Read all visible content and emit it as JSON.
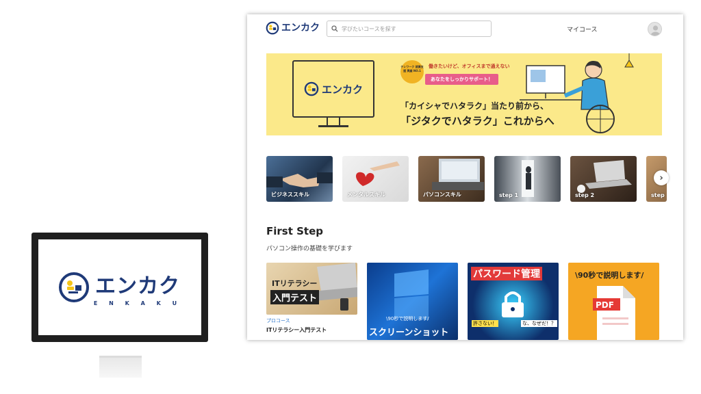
{
  "brand": {
    "logo_text": "エンカク",
    "logo_sub": "E N K A K U"
  },
  "header": {
    "search_placeholder": "学びたいコースを探す",
    "my_course_label": "マイコース"
  },
  "hero": {
    "badge_text": "テレワーク 就業支援 実績 NO.1",
    "small_text": "働きたいけど、オフィスまで通えない",
    "pink_text": "あなたをしっかりサポート！",
    "line1": "「カイシャでハタラク」当たり前から、",
    "line2": "「ジタクでハタラク」これからへ"
  },
  "categories": [
    {
      "label": "ビジネススキル"
    },
    {
      "label": "メンタルスキル"
    },
    {
      "label": "パソコンスキル"
    },
    {
      "label": "step 1"
    },
    {
      "label": "step 2"
    },
    {
      "label": "step"
    }
  ],
  "section": {
    "title": "First Step",
    "subtitle": "パソコン操作の基礎を学びます"
  },
  "courses": [
    {
      "thumb_line1": "ITリテラシー",
      "thumb_line2": "入門テスト",
      "type": "プロコース",
      "name": "ITリテラシー入門テスト"
    },
    {
      "thumb_top": "\\90秒で説明します/",
      "thumb_main": "スクリーンショット"
    },
    {
      "thumb_main": "パスワード管理",
      "thumb_left": "許さない！",
      "thumb_right": "な、なぜだ！？"
    },
    {
      "thumb_top": "\\90秒で説明します/",
      "thumb_main": "PDF"
    }
  ],
  "colors": {
    "brand_navy": "#1f3a78",
    "brand_yellow": "#f5c518",
    "hero_bg": "#fbe98a",
    "link_blue": "#2b74c9"
  }
}
